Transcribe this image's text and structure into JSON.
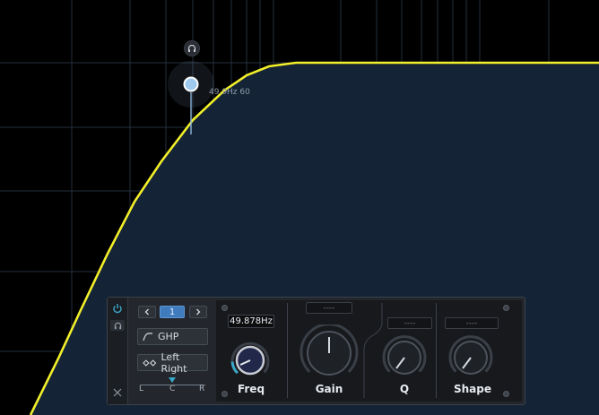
{
  "node": {
    "label": "49.9Hz 60"
  },
  "band": {
    "number": "1"
  },
  "filter_type": {
    "label": "GHP"
  },
  "stereo_mode": {
    "label": "Left Right"
  },
  "pan": {
    "left": "L",
    "center": "C",
    "right": "R"
  },
  "freq": {
    "value": "49.878Hz",
    "label": "Freq",
    "level": 0.15
  },
  "gain": {
    "value": "----",
    "label": "Gain"
  },
  "q": {
    "value": "----",
    "label": "Q"
  },
  "shape": {
    "value": "----",
    "label": "Shape"
  },
  "colors": {
    "curve": "#f2ef2a",
    "fill": "#142436",
    "accent": "#3aa8c8",
    "node": "#9fc9ee",
    "band": "#3f7bbd"
  },
  "icons": [
    "headphones-icon",
    "power-icon",
    "close-icon",
    "chevron-left-icon",
    "chevron-right-icon",
    "highpass-curve-icon",
    "stereo-link-icon"
  ]
}
